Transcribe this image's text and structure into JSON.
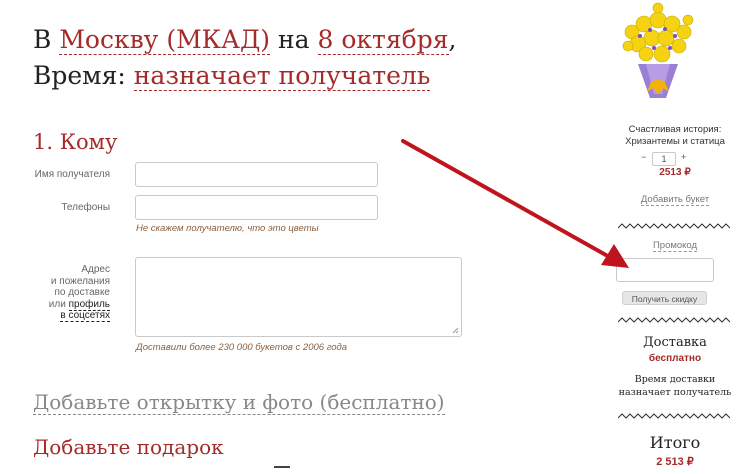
{
  "header": {
    "line1_prefix": "В",
    "city": "Москву (МКАД)",
    "line1_mid": "на",
    "date": "8 октября",
    "line1_comma": ",",
    "time_label": "Время:",
    "time_value": "назначает получатель"
  },
  "form": {
    "section1_title": "1.  Кому",
    "recipient_label": "Имя получателя",
    "phones_label": "Телефоны",
    "phones_hint": "Не скажем получателю, что это цветы",
    "address_label_1": "Адрес",
    "address_label_2": "и пожелания",
    "address_label_3": "по доставке",
    "address_label_4a": "или",
    "address_label_4b": "профиль",
    "address_label_5": "в соцсетях",
    "address_hint": "Доставили более 230 000 букетов с 2006 года",
    "section2_title": "Добавьте открытку и фото (бесплатно)",
    "section3_title": "Добавьте подарок"
  },
  "cart": {
    "product_line1": "Счастливая история:",
    "product_line2": "Хризантемы и статица",
    "minus": "−",
    "qty": "1",
    "plus": "+",
    "price": "2513 ₽",
    "add_bouquet": "Добавить букет",
    "promo_label": "Промокод",
    "promo_button": "Получить скидку",
    "delivery_title": "Доставка",
    "delivery_value": "бесплатно",
    "delivery_time_1": "Время доставки",
    "delivery_time_2": "назначает получатель",
    "total_title": "Итого",
    "total_value": "2 513 ₽"
  },
  "colors": {
    "accent": "#a52a2a",
    "arrow": "#c0141c",
    "zigzag": "#333333",
    "bouquet_flowers": "#f5d312",
    "bouquet_wrap": "#9b7fd4"
  }
}
